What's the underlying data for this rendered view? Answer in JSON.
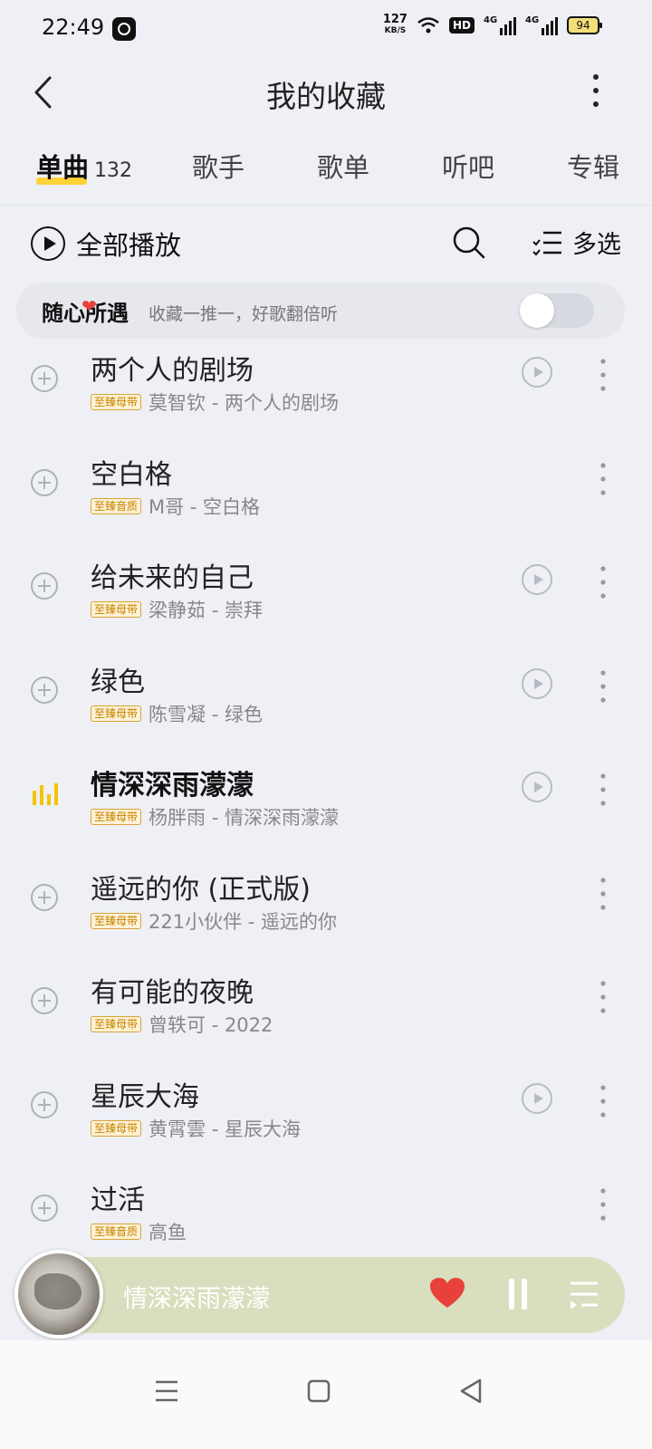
{
  "status_bar": {
    "time": "22:49",
    "net_speed": "127",
    "net_unit": "KB/S",
    "hd_label": "HD",
    "signal1_label": "4G",
    "signal2_label": "4G",
    "battery": "94"
  },
  "header": {
    "title": "我的收藏",
    "back_icon": "chevron-left-icon",
    "more_icon": "more-vertical-icon"
  },
  "tabs": [
    {
      "label": "单曲",
      "count": "132",
      "active": true
    },
    {
      "label": "歌手"
    },
    {
      "label": "歌单"
    },
    {
      "label": "听吧"
    },
    {
      "label": "专辑"
    }
  ],
  "toolbar": {
    "play_all_label": "全部播放",
    "multi_select_label": "多选"
  },
  "random_banner": {
    "title": "随心所遇",
    "subtitle": "收藏一推一，好歌翻倍听",
    "toggle_on": false
  },
  "songs": [
    {
      "title": "两个人的剧场",
      "badge": "至臻母带",
      "artist": "莫智钦 - 两个人的剧场",
      "has_mv": true,
      "playing": false
    },
    {
      "title": "空白格",
      "badge": "至臻音质",
      "artist": "M哥 - 空白格",
      "has_mv": false,
      "playing": false
    },
    {
      "title": "给未来的自己",
      "badge": "至臻母带",
      "artist": "梁静茹 - 崇拜",
      "has_mv": true,
      "playing": false
    },
    {
      "title": "绿色",
      "badge": "至臻母带",
      "artist": "陈雪凝 - 绿色",
      "has_mv": true,
      "playing": false
    },
    {
      "title": "情深深雨濛濛",
      "badge": "至臻母带",
      "artist": "杨胖雨 - 情深深雨濛濛",
      "has_mv": true,
      "playing": true
    },
    {
      "title": "遥远的你 (正式版)",
      "badge": "至臻母带",
      "artist": "221小伙伴 - 遥远的你",
      "has_mv": false,
      "playing": false
    },
    {
      "title": "有可能的夜晚",
      "badge": "至臻母带",
      "artist": "曾轶可 - 2022",
      "has_mv": false,
      "playing": false
    },
    {
      "title": "星辰大海",
      "badge": "至臻母带",
      "artist": "黄霄雲 - 星辰大海",
      "has_mv": true,
      "playing": false
    },
    {
      "title": "过活",
      "badge": "至臻音质",
      "artist": "高鱼",
      "has_mv": false,
      "playing": false
    }
  ],
  "player": {
    "current_title": "情深深雨濛濛",
    "liked": true,
    "state": "playing"
  },
  "colors": {
    "accent_yellow": "#ffd23a",
    "heart_red": "#e8413b",
    "badge_orange": "#c78300",
    "player_bg": "#d9dfbe"
  }
}
